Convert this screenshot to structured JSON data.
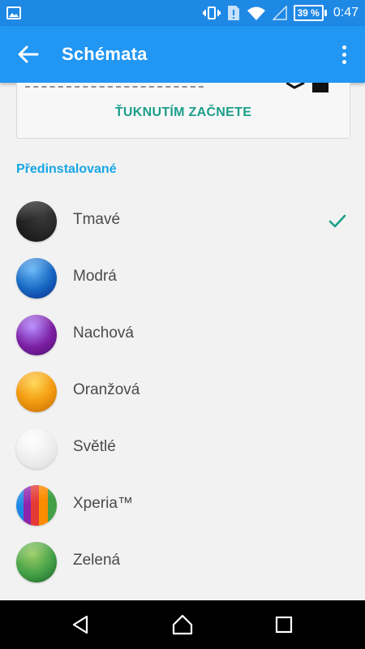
{
  "status_bar": {
    "time": "0:47",
    "battery_percent": "39 %",
    "icons": [
      "image-icon",
      "vibrate-icon",
      "alert-icon",
      "wifi-icon",
      "signal-icon",
      "battery-icon"
    ]
  },
  "app_bar": {
    "title": "Schémata",
    "back_icon": "arrow-left-icon",
    "more_icon": "more-vert-icon"
  },
  "card": {
    "cta_label": "ŤUKNUTÍM ZAČNETE"
  },
  "section": {
    "title": "Předinstalované"
  },
  "themes": [
    {
      "label": "Tmavé",
      "selected": true,
      "color": "#1b1b1b"
    },
    {
      "label": "Modrá",
      "selected": false,
      "color": "#1976d2"
    },
    {
      "label": "Nachová",
      "selected": false,
      "color": "#6a1b9a"
    },
    {
      "label": "Oranžová",
      "selected": false,
      "color": "#f39c12"
    },
    {
      "label": "Světlé",
      "selected": false,
      "color": "#f5f5f5"
    },
    {
      "label": "Xperia™",
      "selected": false,
      "color": "#e53935"
    },
    {
      "label": "Zelená",
      "selected": false,
      "color": "#43a047"
    }
  ],
  "colors": {
    "status_bar": "#1e88e5",
    "app_bar": "#2196f3",
    "accent": "#18a6e5",
    "check": "#1b9e8a"
  },
  "nav_bar": {
    "icons": [
      "back-triangle-icon",
      "home-icon",
      "recents-icon"
    ]
  }
}
